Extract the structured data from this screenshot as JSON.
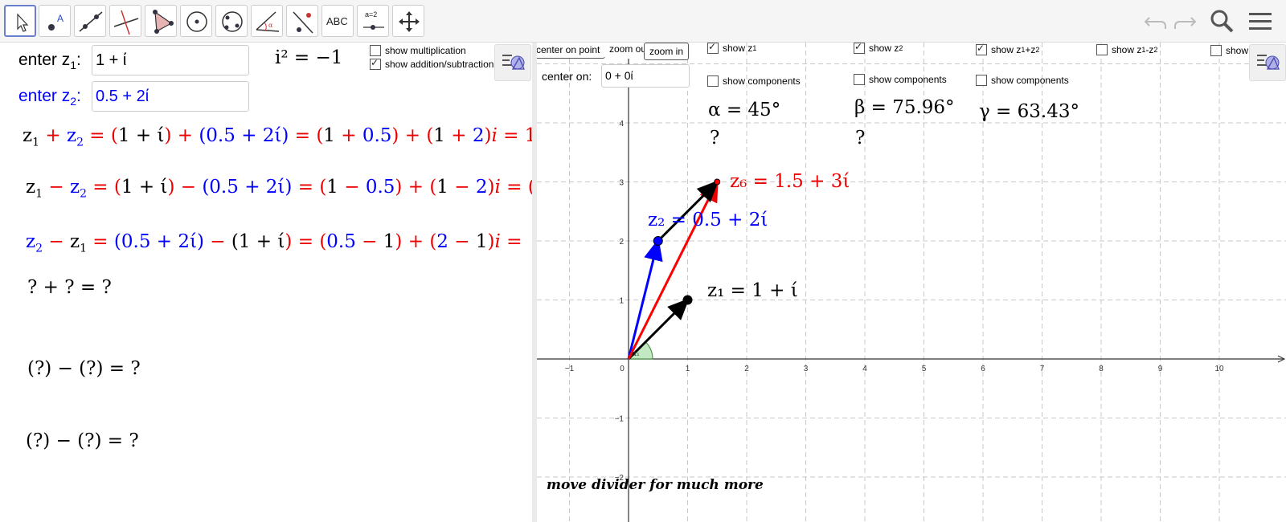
{
  "toolbar": {
    "tools": [
      "move-tool",
      "point-tool",
      "line-tool",
      "perpendicular-tool",
      "polygon-tool",
      "circle-center-tool",
      "circle-three-points-tool",
      "angle-tool",
      "reflect-tool",
      "text-tool",
      "slider-tool",
      "move-graphics-tool"
    ],
    "text_tool_label": "ABC",
    "slider_tool_label": "a=2"
  },
  "algebra": {
    "z1_label": "enter z",
    "z1_sub": "1",
    "z1_colon": ":",
    "z1_value": "1 + ί",
    "z2_label": "enter z",
    "z2_sub": "2",
    "z2_colon": ":",
    "z2_value": "0.5 + 2ί",
    "i_squared": "i² = −1",
    "show_multiplication": "show multiplication",
    "show_addition_subtraction": "show addition/subtraction",
    "mult_checked": false,
    "addsub_checked": true,
    "q1": "? + ? = ?",
    "q2": "(?) − (?) = ?",
    "q3": "(?) − (?) = ?"
  },
  "graphics": {
    "center_on_point": "center on point",
    "zoom_out": "zoom out",
    "zoom_in": "zoom in",
    "center_on_label": "center on:",
    "center_on_value": "0 + 0ί",
    "show_z1": "show z",
    "show_z2": "show z",
    "show_sum": "show z",
    "show_diff": "show z",
    "show_more": "show",
    "show_components": "show components",
    "alpha": "α = 45°",
    "beta": "β = 75.96°",
    "gamma": "γ = 63.43°",
    "q_alpha": "?",
    "q_beta": "?",
    "z6_label": "z₆ = 1.5 + 3ί",
    "z2_label": "z₂ = 0.5 + 2ί",
    "z1_label": "z₁ = 1 + ί",
    "angle_label": "α₁",
    "footer": "move divider for much more",
    "x_ticks": [
      "−1",
      "0",
      "1",
      "2",
      "3",
      "4",
      "5",
      "6",
      "7",
      "8",
      "9",
      "10"
    ],
    "y_ticks": [
      "4",
      "3",
      "2",
      "1",
      "−1",
      "−2"
    ]
  },
  "chart_data": {
    "type": "scatter",
    "points": [
      {
        "name": "z1",
        "x": 1,
        "y": 1,
        "color": "#000000"
      },
      {
        "name": "z2",
        "x": 0.5,
        "y": 2,
        "color": "#0000ff"
      },
      {
        "name": "z6",
        "x": 1.5,
        "y": 3,
        "color": "#ff0000"
      }
    ],
    "vectors": [
      {
        "from": [
          0,
          0
        ],
        "to": [
          1,
          1
        ],
        "color": "#000000"
      },
      {
        "from": [
          0,
          0
        ],
        "to": [
          0.5,
          2
        ],
        "color": "#0000ff"
      },
      {
        "from": [
          0,
          0
        ],
        "to": [
          1.5,
          3
        ],
        "color": "#ff0000"
      },
      {
        "from": [
          0.5,
          2
        ],
        "to": [
          1.5,
          3
        ],
        "color": "#000000"
      }
    ],
    "xlim": [
      -1.7,
      10.7
    ],
    "ylim": [
      -2.6,
      5.3
    ],
    "grid": true
  },
  "colors": {
    "red": "#ff0000",
    "blue": "#0000ff",
    "black": "#000000",
    "angle_fill": "#a8e0a8",
    "grid": "#c8c8c8"
  }
}
